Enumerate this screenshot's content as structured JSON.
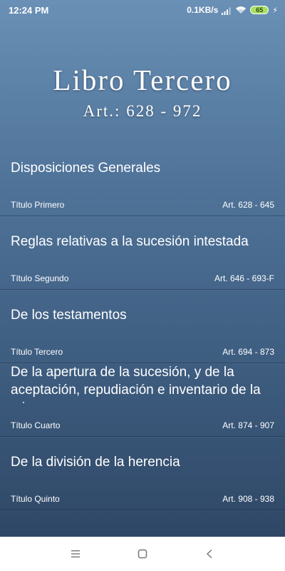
{
  "status_bar": {
    "time": "12:24 PM",
    "net_speed": "0.1KB/s",
    "battery": "65",
    "icons": [
      "signal-icon",
      "wifi-icon",
      "battery-icon",
      "charging-icon"
    ]
  },
  "header": {
    "title": "Libro Tercero",
    "articles": "Art.: 628 - 972"
  },
  "sections": [
    {
      "title": "Disposiciones Generales",
      "subtitle": "Título Primero",
      "range": "Art. 628 - 645"
    },
    {
      "title": "Reglas relativas a la sucesión intestada",
      "subtitle": "Título Segundo",
      "range": "Art. 646 - 693-F"
    },
    {
      "title": "De los testamentos",
      "subtitle": "Título Tercero",
      "range": "Art. 694 - 873"
    },
    {
      "title": "De la apertura de la sucesión, y de la aceptación, repudiación e inventario de la misma",
      "subtitle": "Título Cuarto",
      "range": "Art. 874 - 907"
    },
    {
      "title": "De la división de la herencia",
      "subtitle": "Título Quinto",
      "range": "Art. 908 - 938"
    }
  ],
  "nav_bar": {
    "buttons": [
      "menu-icon",
      "home-icon",
      "back-icon"
    ]
  },
  "colors": {
    "gradient_top": "#6a90b6",
    "gradient_bottom": "#2f4766",
    "text": "#ffffff",
    "battery_fill": "#a8e063"
  }
}
